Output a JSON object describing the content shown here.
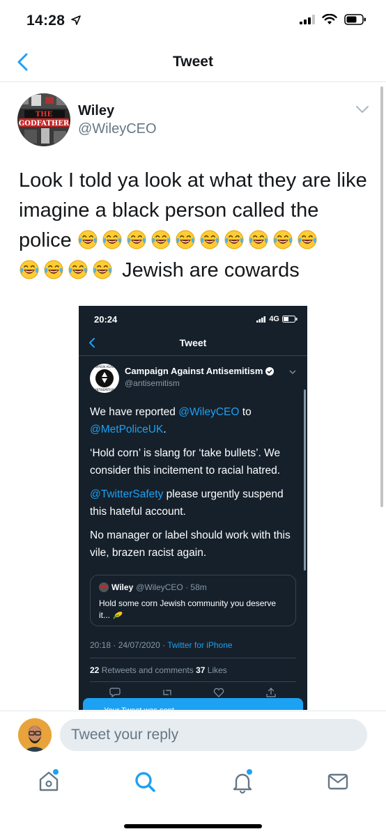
{
  "status_bar": {
    "time": "14:28"
  },
  "nav": {
    "title": "Tweet",
    "back_icon": "chevron-left-icon"
  },
  "tweet": {
    "author_name": "Wiley",
    "author_handle": "@WileyCEO",
    "avatar_text": "THE GODFATHER",
    "text_part1": "Look I told ya look at what they are like imagine a black person called the police",
    "text_part2": "Jewish are cowards",
    "emoji_row1_count": 10,
    "emoji_row2_count": 4,
    "emoji_name": "face-with-tears-of-joy"
  },
  "embedded": {
    "status_time": "20:24",
    "network": "4G",
    "title": "Tweet",
    "account_name": "Campaign Against Antisemitism",
    "account_handle": "@antisemitism",
    "paragraphs": [
      {
        "mention": "",
        "text_a": "We have reported ",
        "mention1": "@WileyCEO",
        "text_b": " to ",
        "mention2": "@MetPoliceUK",
        "text_c": "."
      },
      {
        "text": "‘Hold corn’ is slang for ‘take bullets’. We consider this incitement to racial hatred."
      },
      {
        "mention": "@TwitterSafety",
        "text": " please urgently suspend this hateful account."
      },
      {
        "text": "No manager or label should work with this vile, brazen racist again."
      }
    ],
    "quote": {
      "name": "Wiley",
      "meta": "@WileyCEO · 58m",
      "text": "Hold some corn Jewish community you deserve it..."
    },
    "timestamp": "20:18 · 24/07/2020 · ",
    "source": "Twitter for iPhone",
    "retweets_count": "22",
    "retweets_label": " Retweets and comments ",
    "likes_count": "37",
    "likes_label": " Likes",
    "toast": "Your Tweet was sent"
  },
  "reply": {
    "placeholder": "Tweet your reply"
  },
  "tabs": [
    {
      "name": "home",
      "icon": "home-icon"
    },
    {
      "name": "search",
      "icon": "search-icon"
    },
    {
      "name": "notifications",
      "icon": "bell-icon"
    },
    {
      "name": "messages",
      "icon": "mail-icon"
    }
  ],
  "colors": {
    "accent": "#1da1f2",
    "dark_bg": "#15202b",
    "muted": "#657786"
  }
}
